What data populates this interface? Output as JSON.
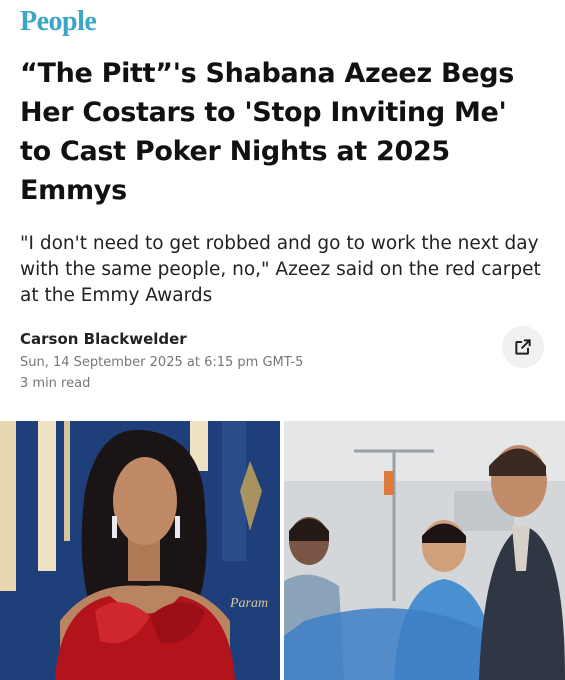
{
  "brand": {
    "logo": "People"
  },
  "article": {
    "headline": "“The Pitt”'s Shabana Azeez Begs Her Costars to 'Stop Inviting Me' to Cast Poker Nights at 2025 Emmys",
    "dek": "\"I don't need to get robbed and go to work the next day with the same people, no,\" Azeez said on the red carpet at the Emmy Awards",
    "author": "Carson Blackwelder",
    "date": "Sun, 14 September 2025 at 6:15 pm GMT-5",
    "read_time": "3 min read",
    "share_icon": "external-link-icon"
  },
  "images": {
    "left": {
      "backdrop_text": "Param"
    }
  },
  "colors": {
    "logo": "#3aa6c8",
    "dress": "#b3141c",
    "backdrop": "#1f3f7a",
    "scrubs": "#4a8fd0"
  }
}
